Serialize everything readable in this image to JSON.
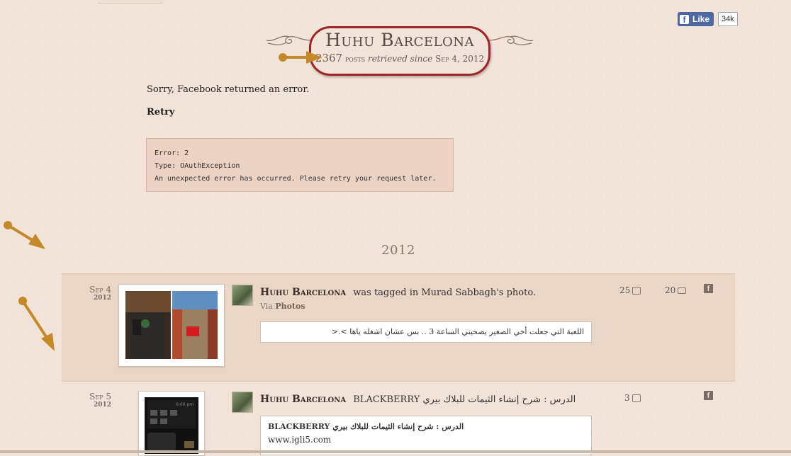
{
  "facebook_like": {
    "label": "Like",
    "count": "34k",
    "icon": "facebook-f-icon"
  },
  "header": {
    "title": "Huhu Barcelona",
    "post_count": "2367",
    "posts_word": "posts",
    "retrieved_text": "retrieved since",
    "since_date": "Sep 4, 2012"
  },
  "error": {
    "message": "Sorry, Facebook returned an error.",
    "retry_label": "Retry",
    "code_line": "Error: 2",
    "type_line": "Type: OAuthException",
    "detail_line": "An unexpected error has occurred. Please retry your request later."
  },
  "timeline": {
    "year": "2012"
  },
  "posts": [
    {
      "date_md": "Sep 4",
      "date_year": "2012",
      "author": "Huhu Barcelona",
      "action": "was tagged in Murad Sabbagh's photo.",
      "via_label": "Via",
      "via_source": "Photos",
      "quote": "اللعبة التي جعلت أخي الصغير يصحيني الساعة 3 .. بس عشان اشغله ياها >.<",
      "likes": "25",
      "comments": "20"
    },
    {
      "date_md": "Sep 5",
      "date_year": "2012",
      "author": "Huhu Barcelona",
      "action": "BLACKBERRY الدرس : شرح إنشاء الثيمات للبلاك بيري",
      "quote_title": "BLACKBERRY الدرس : شرح إنشاء الثيمات للبلاك بيري",
      "quote_url": "www.igli5.com",
      "likes": "3",
      "phone_screen_text": "0:00 pm"
    }
  ],
  "colors": {
    "accent_oval": "#a0232a",
    "arrow": "#c48a2a",
    "page_bg": "#f2e4d8",
    "fb_blue": "#4e69a2"
  }
}
